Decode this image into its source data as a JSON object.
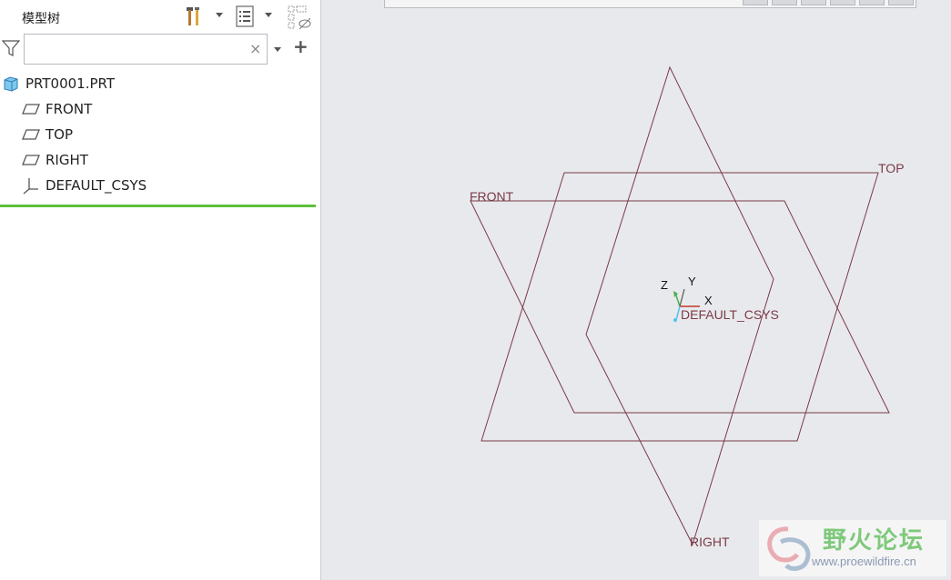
{
  "model_tree": {
    "title": "模型树",
    "search": {
      "value": "",
      "placeholder": ""
    },
    "clear_glyph": "×",
    "add_glyph": "+",
    "items": [
      {
        "label": "PRT0001.PRT",
        "icon": "part-icon"
      },
      {
        "label": "FRONT",
        "icon": "datum-plane-icon"
      },
      {
        "label": "TOP",
        "icon": "datum-plane-icon"
      },
      {
        "label": "RIGHT",
        "icon": "datum-plane-icon"
      },
      {
        "label": "DEFAULT_CSYS",
        "icon": "csys-icon"
      }
    ]
  },
  "graphics": {
    "plane_labels": {
      "front": "FRONT",
      "top": "TOP",
      "right": "RIGHT"
    },
    "csys_label": "DEFAULT_CSYS",
    "axes": {
      "x": "X",
      "y": "Y",
      "z": "Z"
    },
    "colors": {
      "datum_plane": "#7a3a48",
      "background": "#e8e9ec",
      "insert_marker": "#5cc03c"
    }
  },
  "watermark": {
    "title": "野火论坛",
    "url": "www.proewildfire.cn"
  }
}
